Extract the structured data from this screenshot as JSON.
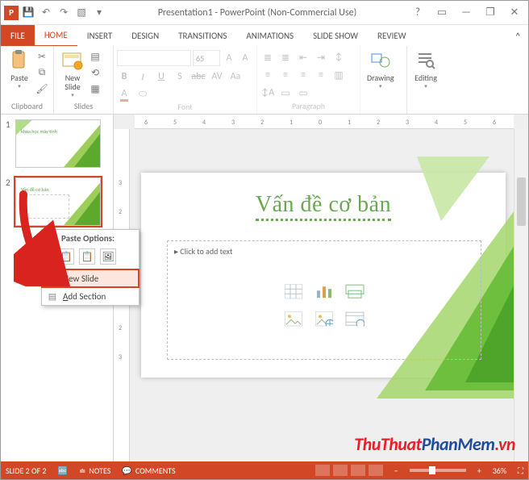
{
  "title": "Presentation1 - PowerPoint (Non-Commercial Use)",
  "tabs": {
    "file": "FILE",
    "home": "HOME",
    "insert": "INSERT",
    "design": "DESIGN",
    "transitions": "TRANSITIONS",
    "animations": "ANIMATIONS",
    "slideshow": "SLIDE SHOW",
    "review": "REVIEW"
  },
  "ribbon": {
    "clipboard": "Clipboard",
    "paste": "Paste",
    "slides": "Slides",
    "newslide": "New\nSlide",
    "font": "Font",
    "paragraph": "Paragraph",
    "drawing": "Drawing",
    "editing": "Editing",
    "fontsize": "65"
  },
  "ruler": {
    "n6": "6",
    "n5": "5",
    "n4": "4",
    "n3": "3",
    "n2": "2",
    "n1": "1",
    "z": "0",
    "p1": "1",
    "p2": "2",
    "p3": "3",
    "p4": "4",
    "p5": "5",
    "p6": "6"
  },
  "slide": {
    "title": "Vấn đề cơ bản",
    "placeholder": "Click to add text"
  },
  "thumbs": {
    "n1": "1",
    "t1": "khoa học máy tính",
    "n2": "2",
    "t2": "Vấn đề cơ bản"
  },
  "context": {
    "paste_header": "Paste Options:",
    "newslide": "New Slide",
    "addsection": "Add Section"
  },
  "status": {
    "counter": "SLIDE 2 OF 2",
    "lang": "",
    "notes": "NOTES",
    "comments": "COMMENTS",
    "zoom": "36%"
  },
  "watermark": {
    "a": "ThuThuat",
    "b": "PhanMem",
    "c": ".vn"
  }
}
